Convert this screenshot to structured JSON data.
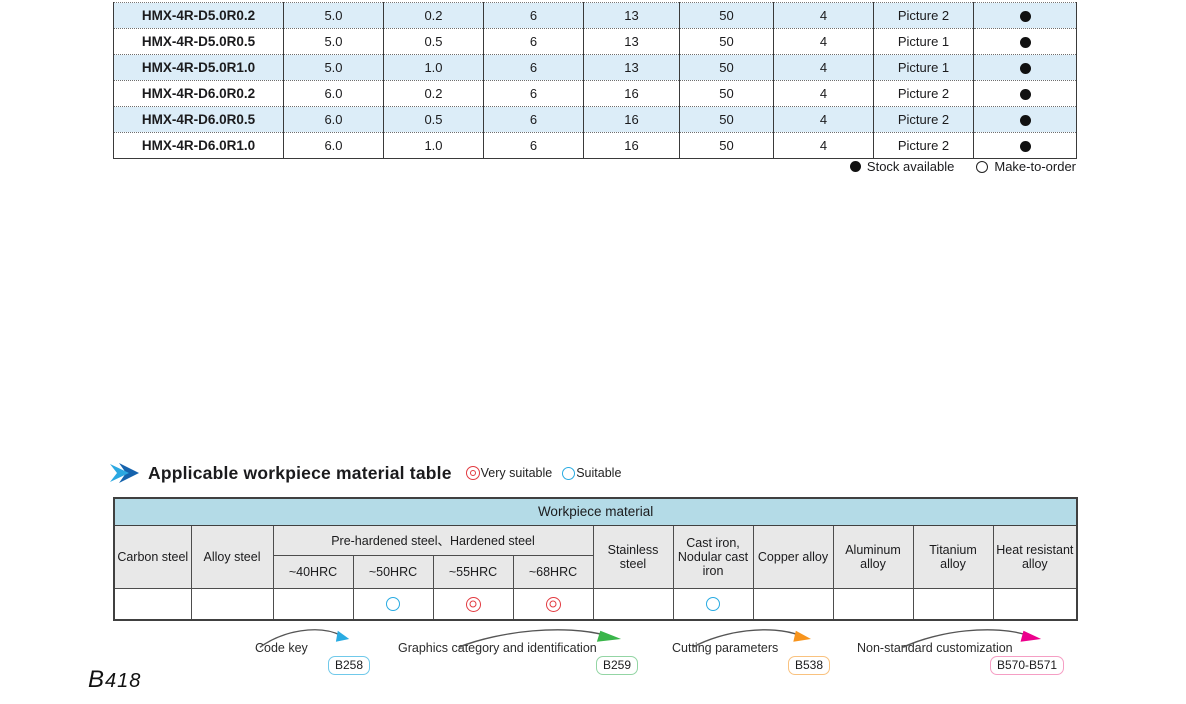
{
  "spec_table": {
    "rows": [
      {
        "cells": [
          "HMX-4R-D5.0R0.2",
          "5.0",
          "0.2",
          "6",
          "13",
          "50",
          "4",
          "Picture 2"
        ],
        "stock": "available"
      },
      {
        "cells": [
          "HMX-4R-D5.0R0.5",
          "5.0",
          "0.5",
          "6",
          "13",
          "50",
          "4",
          "Picture 1"
        ],
        "stock": "available"
      },
      {
        "cells": [
          "HMX-4R-D5.0R1.0",
          "5.0",
          "1.0",
          "6",
          "13",
          "50",
          "4",
          "Picture 1"
        ],
        "stock": "available"
      },
      {
        "cells": [
          "HMX-4R-D6.0R0.2",
          "6.0",
          "0.2",
          "6",
          "16",
          "50",
          "4",
          "Picture 2"
        ],
        "stock": "available"
      },
      {
        "cells": [
          "HMX-4R-D6.0R0.5",
          "6.0",
          "0.5",
          "6",
          "16",
          "50",
          "4",
          "Picture 2"
        ],
        "stock": "available"
      },
      {
        "cells": [
          "HMX-4R-D6.0R1.0",
          "6.0",
          "1.0",
          "6",
          "16",
          "50",
          "4",
          "Picture 2"
        ],
        "stock": "available"
      }
    ]
  },
  "stock_legend": {
    "available": "Stock available",
    "make_to_order": "Make-to-order"
  },
  "material_section": {
    "title": "Applicable workpiece material table",
    "very_suitable_label": "Very suitable",
    "suitable_label": "Suitable"
  },
  "material_table": {
    "banner": "Workpiece material",
    "col_carbon": "Carbon steel",
    "col_alloy": "Alloy steel",
    "group_header": "Pre-hardened steel、Hardened steel",
    "sub_cols": [
      "~40HRC",
      "~50HRC",
      "~55HRC",
      "~68HRC"
    ],
    "col_stainless": "Stainless steel",
    "col_cast_iron": "Cast iron, Nodular cast iron",
    "col_copper": "Copper alloy",
    "col_aluminum": "Aluminum alloy",
    "col_titanium": "Titanium alloy",
    "col_heat": "Heat resistant alloy",
    "ratings": [
      "",
      "",
      "",
      "suitable",
      "very",
      "very",
      "",
      "suitable",
      "",
      "",
      "",
      ""
    ]
  },
  "annotations": [
    {
      "label": "Code key",
      "badge": "B258",
      "arrow_color": "#29abe2",
      "badge_border_color": "#70c9ea"
    },
    {
      "label": "Graphics category and identification",
      "badge": "B259",
      "arrow_color": "#39b54a",
      "badge_border_color": "#93d5a4"
    },
    {
      "label": "Cutting parameters",
      "badge": "B538",
      "arrow_color": "#f7941d",
      "badge_border_color": "#f9c27f"
    },
    {
      "label": "Non-standard customization",
      "badge": "B570-B571",
      "arrow_color": "#ec008c",
      "badge_border_color": "#f59ec4"
    }
  ],
  "colors": {
    "row_alt_blue": "#dcedf8",
    "banner_cyan": "#b4dbe7",
    "header_gray": "#e8e8e8",
    "very_suitable_red": "#e23a40",
    "suitable_blue": "#29abe2"
  },
  "page_number": {
    "prefix": "B",
    "digits": "418"
  }
}
